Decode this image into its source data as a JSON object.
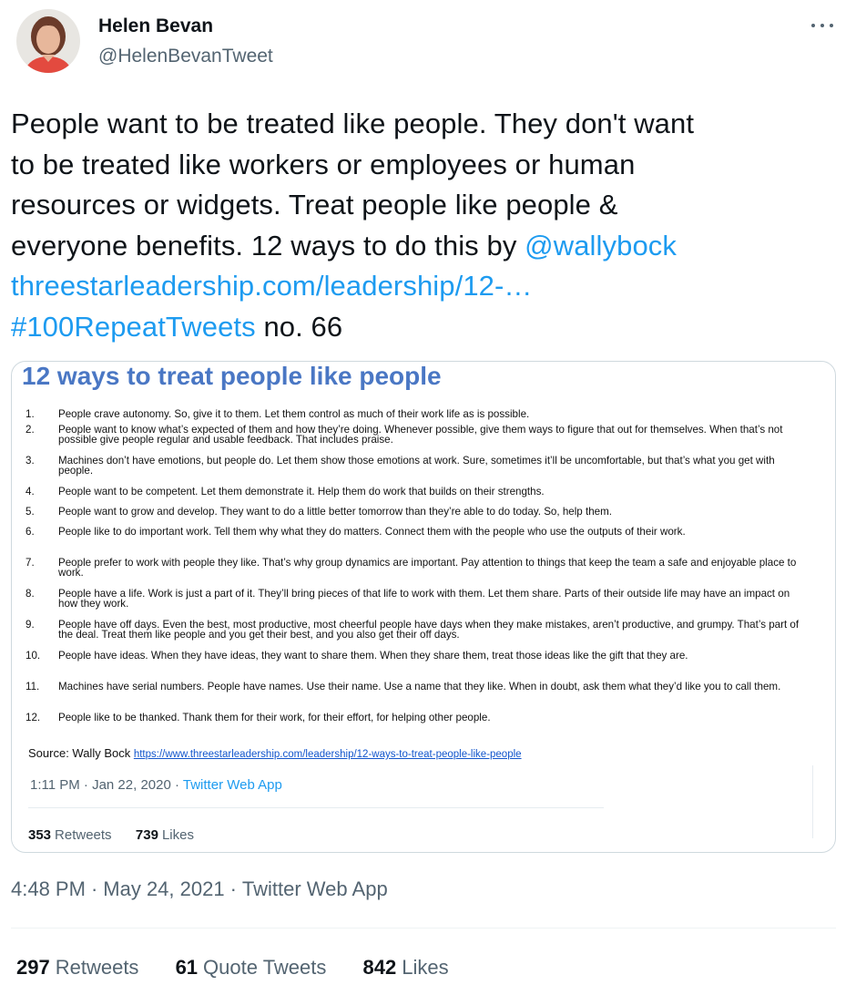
{
  "author": {
    "name": "Helen Bevan",
    "handle": "@HelenBevanTweet"
  },
  "tweet": {
    "lines": [
      "People want to be treated like people. They don't want",
      "to be treated like workers or employees or human",
      "resources or widgets. Treat people like people &",
      "everyone benefits. 12 ways to do this by "
    ],
    "mention": "@wallybock",
    "url": "threestarleadership.com/leadership/12-…",
    "hashtag": "#100RepeatTweets",
    "suffix": " no. 66"
  },
  "quoted_image": {
    "title": "12 ways to treat people like people",
    "items": [
      {
        "num": "1.",
        "text": "People crave autonomy. So, give it to them. Let them control as much of their work life as is possible."
      },
      {
        "num": "2.",
        "text": "People want to know what’s expected of them and how they’re doing. Whenever possible, give them ways to figure that out for themselves. When that’s not possible give people regular and usable feedback. That includes praise."
      },
      {
        "num": "3.",
        "text": "Machines don’t have emotions, but people do. Let them show those emotions at work. Sure, sometimes it’ll be uncomfortable, but that’s what you get with people."
      },
      {
        "num": "4.",
        "text": "People want to be competent. Let them demonstrate it. Help them do work that builds on their strengths."
      },
      {
        "num": "5.",
        "text": "People want to grow and develop. They want to do a little better tomorrow than they’re able to do today. So, help them."
      },
      {
        "num": "6.",
        "text": "People like to do important work. Tell them why what they do matters. Connect them with the people who use the outputs of their work."
      },
      {
        "num": "7.",
        "text": "People prefer to work with people they like. That’s why group dynamics are important. Pay attention to things that keep the team a safe and enjoyable place to work."
      },
      {
        "num": "8.",
        "text": "People have a life. Work is just a part of it. They’ll bring pieces of that life to work with them. Let them share. Parts of their outside life may have an impact on how they work."
      },
      {
        "num": "9.",
        "text": "People have off days. Even the best, most productive, most cheerful people have days when they make mistakes, aren’t productive, and grumpy. That’s part of the deal. Treat them like people and you get their best, and you also get their off days."
      },
      {
        "num": "10.",
        "text": "People have ideas. When they have ideas, they want to share them. When they share them, treat those ideas like the gift that they are."
      },
      {
        "num": "11.",
        "text": "Machines have serial numbers. People have names. Use their name. Use a name that they like. When in doubt, ask them what they’d like you to call them."
      },
      {
        "num": "12.",
        "text": "People like to be thanked. Thank them for their work, for their effort, for helping other people."
      }
    ],
    "source_label": "Source: Wally Bock ",
    "source_url": "https://www.threestarleadership.com/leadership/12-ways-to-treat-people-like-people",
    "quoted_time": "1:11 PM · Jan 22, 2020 · ",
    "quoted_app": "Twitter Web App",
    "quoted_retweets": "353",
    "quoted_retweets_label": "Retweets",
    "quoted_likes": "739",
    "quoted_likes_label": "Likes"
  },
  "meta": {
    "time": "4:48 PM",
    "date": "May 24, 2021",
    "app": "Twitter Web App"
  },
  "stats": {
    "retweets": "297",
    "retweets_label": "Retweets",
    "quotes": "61",
    "quotes_label": "Quote Tweets",
    "likes": "842",
    "likes_label": "Likes"
  }
}
